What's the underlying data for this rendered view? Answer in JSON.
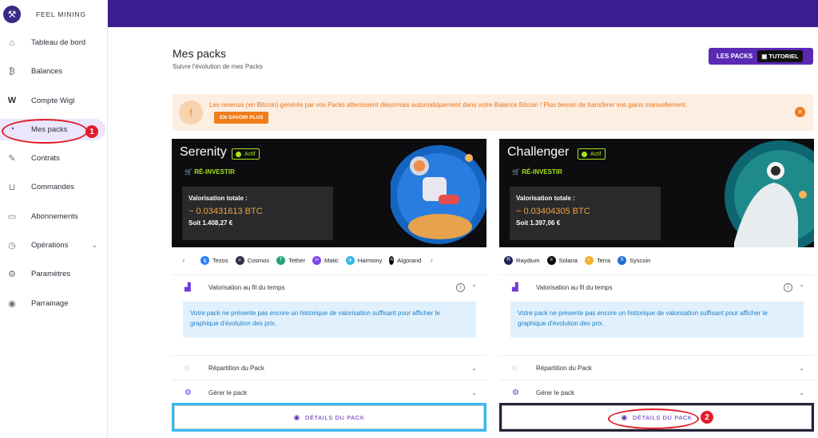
{
  "brand": {
    "name": "FEEL MINING",
    "logo_icon": "pickaxe-icon"
  },
  "sidebar": {
    "items": [
      {
        "label": "Tableau de bord",
        "icon": "home-icon"
      },
      {
        "label": "Balances",
        "icon": "bitcoin-icon"
      },
      {
        "label": "Compte Wigl",
        "icon": "wigl-icon"
      },
      {
        "label": "Mes packs",
        "icon": "pack-icon",
        "active": true
      },
      {
        "label": "Contrats",
        "icon": "contract-icon"
      },
      {
        "label": "Commandes",
        "icon": "basket-icon"
      },
      {
        "label": "Abonnements",
        "icon": "card-icon"
      },
      {
        "label": "Opérations",
        "icon": "operations-icon"
      },
      {
        "label": "Paramètres",
        "icon": "gear-icon"
      },
      {
        "label": "Parrainage",
        "icon": "referral-icon"
      }
    ]
  },
  "annotations": {
    "one": "1",
    "two": "2"
  },
  "page": {
    "title": "Mes packs",
    "subtitle": "Suivre l'évolution de mes Packs"
  },
  "top_button": {
    "label": "LES PACKS",
    "tutorial": "TUTORIEL"
  },
  "alert": {
    "text": "Les revenus (en Bitcoin) générés par vos Packs atterrissent désormais automatiquement dans votre Balance Bitcoin ! Plus besoin de transférer vos gains manuellement.",
    "button": "EN SAVOIR PLUS"
  },
  "packs": [
    {
      "name": "Serenity",
      "status": "Actif",
      "reinvest": "RÉ-INVESTIR",
      "valuation_label": "Valorisation totale :",
      "btc": "~ 0.03431613 BTC",
      "eur": "Soit 1.408,27 €",
      "coins": [
        "Tezos",
        "Cosmos",
        "Tether",
        "Matic",
        "Harmony",
        "Algorand"
      ],
      "section_valuation": "Valorisation au fil du temps",
      "info": "Votre pack ne présente pas encore un historique de valorisation suffisant pour afficher le graphique d'évolution des prix.",
      "section_repartition": "Répartition du Pack",
      "section_manage": "Gérer le pack",
      "details": "DÉTAILS DU PACK"
    },
    {
      "name": "Challenger",
      "status": "Actif",
      "reinvest": "RÉ-INVESTIR",
      "valuation_label": "Valorisation totale :",
      "btc": "~ 0.03404305 BTC",
      "eur": "Soit 1.397,06 €",
      "coins": [
        "Raydium",
        "Solana",
        "Terra",
        "Syscoin"
      ],
      "section_valuation": "Valorisation au fil du temps",
      "info": "Votre pack ne présente pas encore un historique de valorisation suffisant pour afficher le graphique d'évolution des prix.",
      "section_repartition": "Répartition du Pack",
      "section_manage": "Gérer le pack",
      "details": "DÉTAILS DU PACK"
    }
  ],
  "colors": {
    "primary": "#3b1d8f",
    "accent": "#5b2ab5",
    "lime": "#a7e31b",
    "orange": "#f07c1a",
    "annotation": "#e11d2a"
  }
}
